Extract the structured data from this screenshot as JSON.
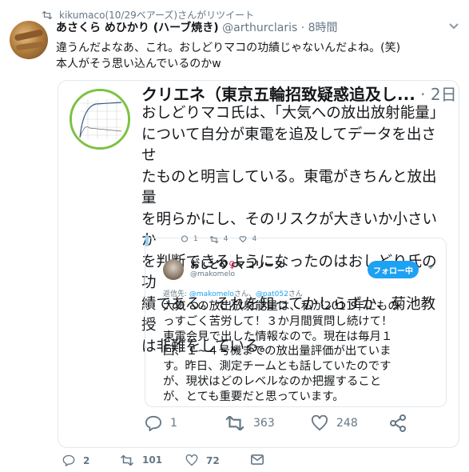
{
  "retweet": {
    "icon": "retweet-icon",
    "text": "kikumaco(10/29ベアーズ)さんがリツイート"
  },
  "tweet": {
    "name": "あさくら めひかり (ハーブ焼き)",
    "handle": "@arthurclaris",
    "time": "· 8時間",
    "lines": [
      "違うんだよなあ、これ。おしどりマコの功績じゃないんだよね。(笑)",
      "本人がそう思い込んでいるのかw"
    ]
  },
  "quote": {
    "name": "クリエネ（東京五輪招致疑惑追及し...",
    "time": "· 2日",
    "lines": [
      "おしどりマコ氏は、「大気への放出放射能量」",
      "について自分が東電を追及してデータを出させ",
      "たものと明言している。東電がきちんと放出量",
      "を明らかにし、そのリスクが大きいか小さいか",
      "を判断できるようになったのはおしどり氏の功",
      "績である。それを知ってかしらずか、菊池教授",
      "は非難をしている。"
    ],
    "actions": {
      "reply": "1",
      "retweet": "363",
      "like": "248"
    }
  },
  "inner": {
    "actions": {
      "reply": "1",
      "retweet": "4",
      "like": "4"
    },
    "name_prefix": "おしどり",
    "name_pin": "♀",
    "name_suffix": "マコリーヌ",
    "handle": "@makomelo",
    "follow_label": "フォロー中",
    "reply_prefix": "返信先: ",
    "reply_user1": "@makomelo",
    "reply_mid": "さん、",
    "reply_user2": "@pat052",
    "reply_suffix": "さん",
    "lines": [
      "大気への放出放射能量は、私が2011年にもの",
      "っすごく苦労して！３か月間質問し続けて！",
      "東電会見で出した情報なので。現在は毎月１",
      "回、１~４号機までの放出量評価が出ていま",
      "す。昨日、測定チームとも話していたのです",
      "が、現状はどのレベルなのか把握すること",
      "が、とても重要だと思っています。"
    ]
  },
  "footer": {
    "reply": "2",
    "retweet": "101",
    "like": "72"
  },
  "colors": {
    "accent": "#1da1f2",
    "muted": "#657786",
    "border": "#e1e8ed",
    "pin": "#e0245e"
  }
}
